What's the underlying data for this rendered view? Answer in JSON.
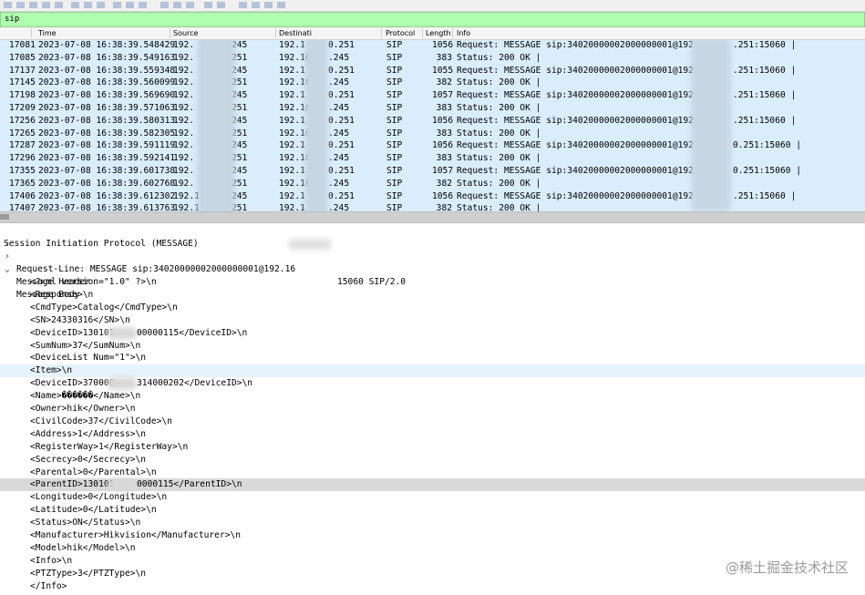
{
  "filter": {
    "value": "sip"
  },
  "columns": {
    "no": "",
    "time": "Time",
    "source": "Source",
    "destination": "Destinati",
    "protocol": "Protocol",
    "length": "Length",
    "info": "Info"
  },
  "packets": [
    {
      "no": "17081",
      "time": "2023-07-08 16:38:39.548429",
      "src_a": "192.",
      "src_b": "245",
      "dst_a": "192.1",
      "dst_b": "0.251",
      "proto": "SIP",
      "len": "1056",
      "info": "Request: MESSAGE sip:34020000002000000001@192.",
      "info_tail": ".251:15060 |"
    },
    {
      "no": "17085",
      "time": "2023-07-08 16:38:39.549163",
      "src_a": "192.",
      "src_b": "251",
      "dst_a": "192.16",
      "dst_b": ".245",
      "proto": "SIP",
      "len": "383",
      "info": "Status: 200 OK |",
      "info_tail": ""
    },
    {
      "no": "17137",
      "time": "2023-07-08 16:38:39.559348",
      "src_a": "192.",
      "src_b": "245",
      "dst_a": "192.1",
      "dst_b": "0.251",
      "proto": "SIP",
      "len": "1055",
      "info": "Request: MESSAGE sip:34020000002000000001@192.",
      "info_tail": ".251:15060 |"
    },
    {
      "no": "17145",
      "time": "2023-07-08 16:38:39.560099",
      "src_a": "192.",
      "src_b": "251",
      "dst_a": "192.16",
      "dst_b": ".245",
      "proto": "SIP",
      "len": "382",
      "info": "Status: 200 OK |",
      "info_tail": ""
    },
    {
      "no": "17198",
      "time": "2023-07-08 16:38:39.569690",
      "src_a": "192.",
      "src_b": "245",
      "dst_a": "192.1",
      "dst_b": "0.251",
      "proto": "SIP",
      "len": "1057",
      "info": "Request: MESSAGE sip:34020000002000000001@192.1",
      "info_tail": ".251:15060 |"
    },
    {
      "no": "17209",
      "time": "2023-07-08 16:38:39.571063",
      "src_a": "192.",
      "src_b": "251",
      "dst_a": "192.16",
      "dst_b": ".245",
      "proto": "SIP",
      "len": "383",
      "info": "Status: 200 OK |",
      "info_tail": ""
    },
    {
      "no": "17256",
      "time": "2023-07-08 16:38:39.580313",
      "src_a": "192.",
      "src_b": "245",
      "dst_a": "192.1",
      "dst_b": "0.251",
      "proto": "SIP",
      "len": "1056",
      "info": "Request: MESSAGE sip:34020000002000000001@192.",
      "info_tail": ".251:15060 |"
    },
    {
      "no": "17265",
      "time": "2023-07-08 16:38:39.582305",
      "src_a": "192.",
      "src_b": "251",
      "dst_a": "192.16",
      "dst_b": ".245",
      "proto": "SIP",
      "len": "383",
      "info": "Status: 200 OK |",
      "info_tail": ""
    },
    {
      "no": "17287",
      "time": "2023-07-08 16:38:39.591119",
      "src_a": "192.",
      "src_b": "245",
      "dst_a": "192.1",
      "dst_b": "0.251",
      "proto": "SIP",
      "len": "1056",
      "info": "Request: MESSAGE sip:34020000002000000001@192.",
      "info_tail": "0.251:15060 |"
    },
    {
      "no": "17296",
      "time": "2023-07-08 16:38:39.592141",
      "src_a": "192.",
      "src_b": "251",
      "dst_a": "192.16",
      "dst_b": ".245",
      "proto": "SIP",
      "len": "383",
      "info": "Status: 200 OK |",
      "info_tail": ""
    },
    {
      "no": "17355",
      "time": "2023-07-08 16:38:39.601738",
      "src_a": "192.",
      "src_b": "245",
      "dst_a": "192.1",
      "dst_b": "0.251",
      "proto": "SIP",
      "len": "1057",
      "info": "Request: MESSAGE sip:34020000002000000001@192",
      "info_tail": "0.251:15060 |"
    },
    {
      "no": "17365",
      "time": "2023-07-08 16:38:39.602768",
      "src_a": "192.",
      "src_b": "251",
      "dst_a": "192.16",
      "dst_b": ".245",
      "proto": "SIP",
      "len": "382",
      "info": "Status: 200 OK |",
      "info_tail": ""
    },
    {
      "no": "17406",
      "time": "2023-07-08 16:38:39.612302",
      "src_a": "192.1",
      "src_b": "245",
      "dst_a": "192.1",
      "dst_b": "0.251",
      "proto": "SIP",
      "len": "1056",
      "info": "Request: MESSAGE sip:34020000002000000001@192.",
      "info_tail": ".251:15060 |"
    },
    {
      "no": "17407",
      "time": "2023-07-08 16:38:39.613763",
      "src_a": "192.1",
      "src_b": "251",
      "dst_a": "192.1",
      "dst_b": ".245",
      "proto": "SIP",
      "len": "382",
      "info": "Status: 200 OK |",
      "info_tail": ""
    }
  ],
  "detail": {
    "title": "Session Initiation Protocol (MESSAGE)",
    "request_line": "Request-Line: MESSAGE sip:34020000002000000001@192.16",
    "request_line_tail": "15060 SIP/2.0",
    "message_header": "Message Header",
    "message_body": "Message Body",
    "body_lines": [
      "<?xml version=\"1.0\" ?>\\n",
      "<Response>\\n",
      "<CmdType>Catalog</CmdType>\\n",
      "<SN>24330316</SN>\\n",
      "<DeviceID>130101",
      "<SumNum>37</SumNum>\\n",
      "<DeviceList Num=\"1\">\\n",
      "<Item>\\n",
      "<DeviceID>370000",
      "<Name>������</Name>\\n",
      "<Owner>hik</Owner>\\n",
      "<CivilCode>37</CivilCode>\\n",
      "<Address>1</Address>\\n",
      "<RegisterWay>1</RegisterWay>\\n",
      "<Secrecy>0</Secrecy>\\n",
      "<Parental>0</Parental>\\n",
      "<ParentID>130101",
      "<Longitude>0</Longitude>\\n",
      "<Latitude>0</Latitude>\\n",
      "<Status>ON</Status>\\n",
      "<Manufacturer>Hikvision</Manufacturer>\\n",
      "<Model>hik</Model>\\n",
      "<Info>\\n",
      "<PTZType>3</PTZType>\\n",
      "</Info>"
    ],
    "body_tails": {
      "4": "00000115</DeviceID>\\n",
      "8": "314000202</DeviceID>\\n",
      "16": "0000115</ParentID>\\n"
    }
  },
  "watermark": "@稀土掘金技术社区"
}
